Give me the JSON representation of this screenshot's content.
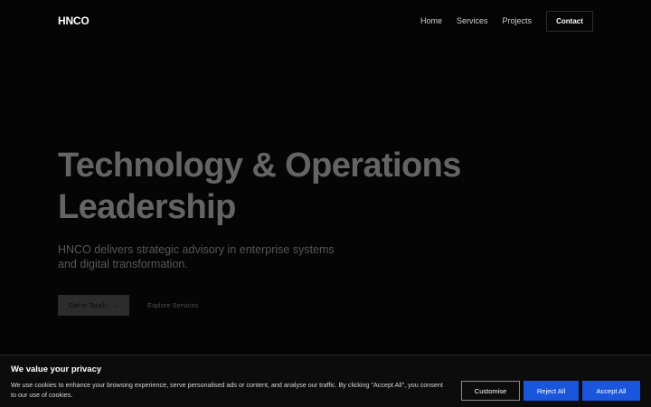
{
  "header": {
    "logo": "HNCO",
    "nav": [
      "Home",
      "Services",
      "Projects"
    ],
    "contact_label": "Contact"
  },
  "hero": {
    "title_line1": "Technology & Operations",
    "title_line2": "Leadership",
    "subtitle_line1": "HNCO delivers strategic advisory in enterprise systems",
    "subtitle_line2": "and digital transformation.",
    "primary_cta": "Get in Touch",
    "primary_cta_arrow": "→",
    "secondary_cta": "Explore Services"
  },
  "cookie": {
    "title": "We value your privacy",
    "text": "We use cookies to enhance your browsing experience, serve personalised ads or content, and analyse our traffic. By clicking \"Accept All\", you consent to our use of cookies.",
    "customise_label": "Customise",
    "reject_label": "Reject All",
    "accept_label": "Accept All"
  },
  "colors": {
    "background": "#050505",
    "accent": "#1a56db"
  }
}
